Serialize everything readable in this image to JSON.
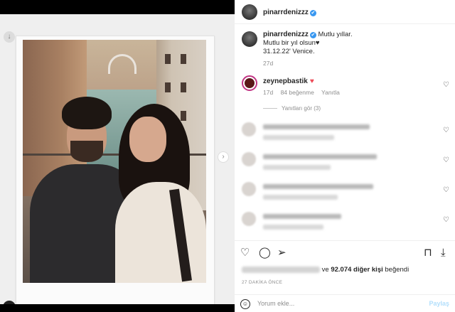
{
  "post": {
    "author": "pinarrdenizzz",
    "verified_mark": "✔",
    "caption_lines": [
      "Mutlu yıllar.",
      "Mutlu bir yıl olsun♥",
      "31.12.22' Venice."
    ],
    "caption_age": "27d"
  },
  "media": {
    "download_icon": "↓",
    "next_icon": "›",
    "account_icon": "●",
    "carousel_dots": 3,
    "active_dot": 0
  },
  "comments": [
    {
      "user": "zeynepbastik",
      "emoji": "♥",
      "age": "17d",
      "likes": "84 beğenme",
      "reply_label": "Yanıtla",
      "view_replies": "Yanıtları gör (3)"
    }
  ],
  "actions": {
    "like_icon": "♡",
    "comment_icon": "◯",
    "share_icon": "➢",
    "save_icon": "⊓",
    "download_icon": "⤓"
  },
  "likes_summary": {
    "prefix": "ve",
    "count": "92.074",
    "unit": "diğer kişi",
    "suffix": "beğendi"
  },
  "post_time": "27 DAKİKA ÖNCE",
  "comment_box": {
    "emoji_icon": "☺",
    "placeholder": "Yorum ekle...",
    "post_label": "Paylaş"
  },
  "colors": {
    "verified": "#3897f0",
    "heart": "#ed4956",
    "post_button": "#b2dffc",
    "active_dot": "#0095f6"
  }
}
